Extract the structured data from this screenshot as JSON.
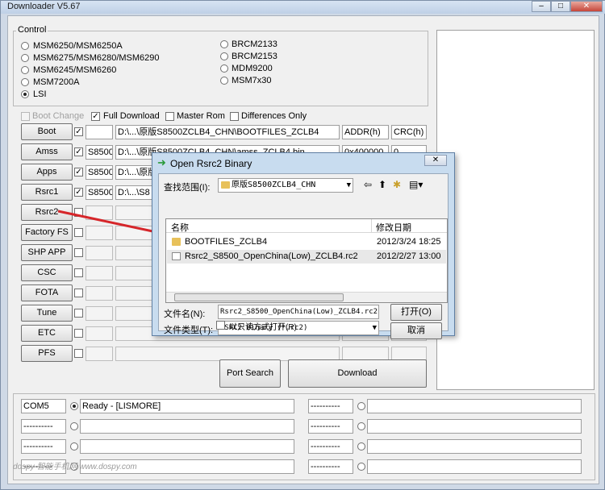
{
  "window": {
    "title": "Downloader V5.67",
    "minimize": "–",
    "maximize": "□",
    "close": "✕"
  },
  "control": {
    "legend": "Control",
    "radios_left": [
      "MSM6250/MSM6250A",
      "MSM6275/MSM6280/MSM6290",
      "MSM6245/MSM6260",
      "MSM7200A",
      "LSI"
    ],
    "radios_right": [
      "BRCM2133",
      "BRCM2153",
      "MDM9200",
      "MSM7x30"
    ],
    "selected": "LSI"
  },
  "options": {
    "boot_change": "Boot Change",
    "full_download": "Full Download",
    "master_rom": "Master Rom",
    "differences_only": "Differences Only"
  },
  "rows": [
    {
      "label": "Boot",
      "checked": true,
      "tag": "",
      "path": "D:\\...\\原版S8500ZCLB4_CHN\\BOOTFILES_ZCLB4",
      "addr": "ADDR(h)",
      "crc": "CRC(h)"
    },
    {
      "label": "Amss",
      "checked": true,
      "tag": "S8500",
      "path": "D:\\...\\原版S8500ZCLB4_CHN\\amss_ZCLB4.bin",
      "addr": "0x400000",
      "crc": "0"
    },
    {
      "label": "Apps",
      "checked": true,
      "tag": "S8500",
      "path": "D:\\...\\原版",
      "addr": "",
      "crc": ""
    },
    {
      "label": "Rsrc1",
      "checked": true,
      "tag": "S8500",
      "path": "D:\\...\\S8",
      "addr": "",
      "crc": ""
    },
    {
      "label": "Rsrc2",
      "checked": false,
      "tag": "",
      "path": "",
      "addr": "",
      "crc": ""
    },
    {
      "label": "Factory FS",
      "checked": false,
      "tag": "",
      "path": "",
      "addr": "",
      "crc": ""
    },
    {
      "label": "SHP APP",
      "checked": false,
      "tag": "",
      "path": "",
      "addr": "",
      "crc": ""
    },
    {
      "label": "CSC",
      "checked": false,
      "tag": "",
      "path": "",
      "addr": "",
      "crc": ""
    },
    {
      "label": "FOTA",
      "checked": false,
      "tag": "",
      "path": "",
      "addr": "",
      "crc": ""
    },
    {
      "label": "Tune",
      "checked": false,
      "tag": "",
      "path": "",
      "addr": "",
      "crc": ""
    },
    {
      "label": "ETC",
      "checked": false,
      "tag": "",
      "path": "",
      "addr": "",
      "crc": ""
    },
    {
      "label": "PFS",
      "checked": false,
      "tag": "",
      "path": "",
      "addr": "",
      "crc": ""
    }
  ],
  "buttons": {
    "port_search": "Port Search",
    "download": "Download"
  },
  "ports": [
    {
      "port": "COM5",
      "status": "Ready - [LISMORE]",
      "selected": true
    },
    {
      "port": "----------",
      "status": "",
      "selected": false
    },
    {
      "port": "----------",
      "status": "",
      "selected": false
    },
    {
      "port": "----------",
      "status": "",
      "selected": false
    },
    {
      "port": "----------",
      "status": "",
      "selected": false
    },
    {
      "port": "----------",
      "status": "",
      "selected": false
    },
    {
      "port": "----------",
      "status": "",
      "selected": false
    },
    {
      "port": "----------",
      "status": "",
      "selected": false
    }
  ],
  "dialog": {
    "title": "Open Rsrc2 Binary",
    "look_in_label": "查找范围(I):",
    "look_in_value": "原版S8500ZCLB4_CHN",
    "col_name": "名称",
    "col_date": "修改日期",
    "files": [
      {
        "name": "BOOTFILES_ZCLB4",
        "date": "2012/3/24 18:25",
        "type": "folder"
      },
      {
        "name": "Rsrc2_S8500_OpenChina(Low)_ZCLB4.rc2",
        "date": "2012/2/27 13:00",
        "type": "file"
      }
    ],
    "filename_label": "文件名(N):",
    "filename_value": "Rsrc2_S8500_OpenChina(Low)_ZCLB4.rc2",
    "filetype_label": "文件类型(T):",
    "filetype_value": "RSRC2 Binary (*.rc2)",
    "readonly_label": "以只读方式打开(R)",
    "open_button": "打开(O)",
    "cancel_button": "取消"
  },
  "watermark": "dospy 智能手机网 www.dospy.com",
  "colors": {
    "arrow": "#d6262a",
    "folder": "#e8c15a",
    "title_icon": "#2a9a3a"
  }
}
